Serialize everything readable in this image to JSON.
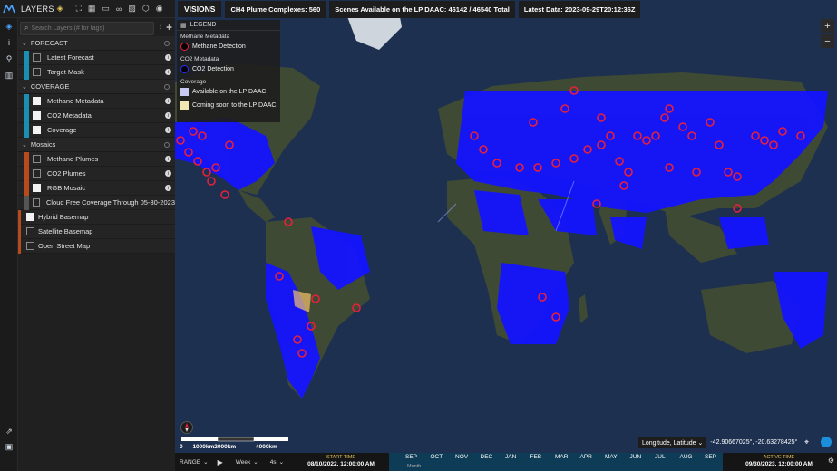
{
  "brand": {
    "title": "LAYERS"
  },
  "search": {
    "placeholder": "Search Layers (# for tags)"
  },
  "groups": [
    {
      "name": "FORECAST",
      "layers": [
        {
          "label": "Latest Forecast",
          "checked": false,
          "stripe": "blue"
        },
        {
          "label": "Target Mask",
          "checked": false,
          "stripe": "blue"
        }
      ]
    },
    {
      "name": "COVERAGE",
      "layers": [
        {
          "label": "Methane Metadata",
          "checked": true,
          "stripe": "blue"
        },
        {
          "label": "CO2 Metadata",
          "checked": true,
          "stripe": "blue"
        },
        {
          "label": "Coverage",
          "checked": true,
          "stripe": "blue"
        }
      ]
    },
    {
      "name": "Mosaics",
      "layers": [
        {
          "label": "Methane Plumes",
          "checked": false,
          "stripe": "orange"
        },
        {
          "label": "CO2 Plumes",
          "checked": false,
          "stripe": "orange"
        },
        {
          "label": "RGB Mosaic",
          "checked": true,
          "stripe": "orange"
        },
        {
          "label": "Cloud Free Coverage Through 05-30-2023",
          "checked": false,
          "stripe": "grey"
        }
      ]
    }
  ],
  "basemaps": [
    {
      "label": "Hybrid Basemap",
      "checked": true
    },
    {
      "label": "Satellite Basemap",
      "checked": false
    },
    {
      "label": "Open Street Map",
      "checked": false
    }
  ],
  "infobar": {
    "visions": "VISIONS",
    "plume_complexes": "CH4 Plume Complexes: 560",
    "scenes": "Scenes Available on the LP DAAC: 46142 / 46540 Total",
    "latest": "Latest Data: 2023-09-29T20:12:36Z"
  },
  "legend": {
    "title": "LEGEND",
    "sec1": "Methane Metadata",
    "item1": "Methane Detection",
    "sec2": "CO2 Metadata",
    "item2": "CO2 Detection",
    "sec3": "Coverage",
    "item3": "Available on the LP DAAC",
    "item4": "Coming soon to the LP DAAC",
    "colors": {
      "available": "#c8c8f0",
      "soon": "#f0e8b4"
    }
  },
  "scale": {
    "l0": "0",
    "l1": "1000km",
    "l2": "2000km",
    "l3": "4000km"
  },
  "coords": {
    "projection": "Longitude, Latitude",
    "value": "-42.90667025°, -20.63278425°"
  },
  "timeline": {
    "range_label": "RANGE",
    "step_label": "Week",
    "speed_label": "4s",
    "start_label": "START TIME",
    "start_value": "08/10/2022, 12:00:00 AM",
    "active_label": "ACTIVE TIME",
    "active_value": "09/30/2023, 12:00:00 AM",
    "months": [
      "SEP",
      "OCT",
      "NOV",
      "DEC",
      "JAN",
      "FEB",
      "MAR",
      "APR",
      "MAY",
      "JUN",
      "JUL",
      "AUG",
      "SEP"
    ],
    "sub_label": "Month"
  },
  "colors": {
    "coverage": "#1414ff",
    "detection": "#e8203b"
  }
}
